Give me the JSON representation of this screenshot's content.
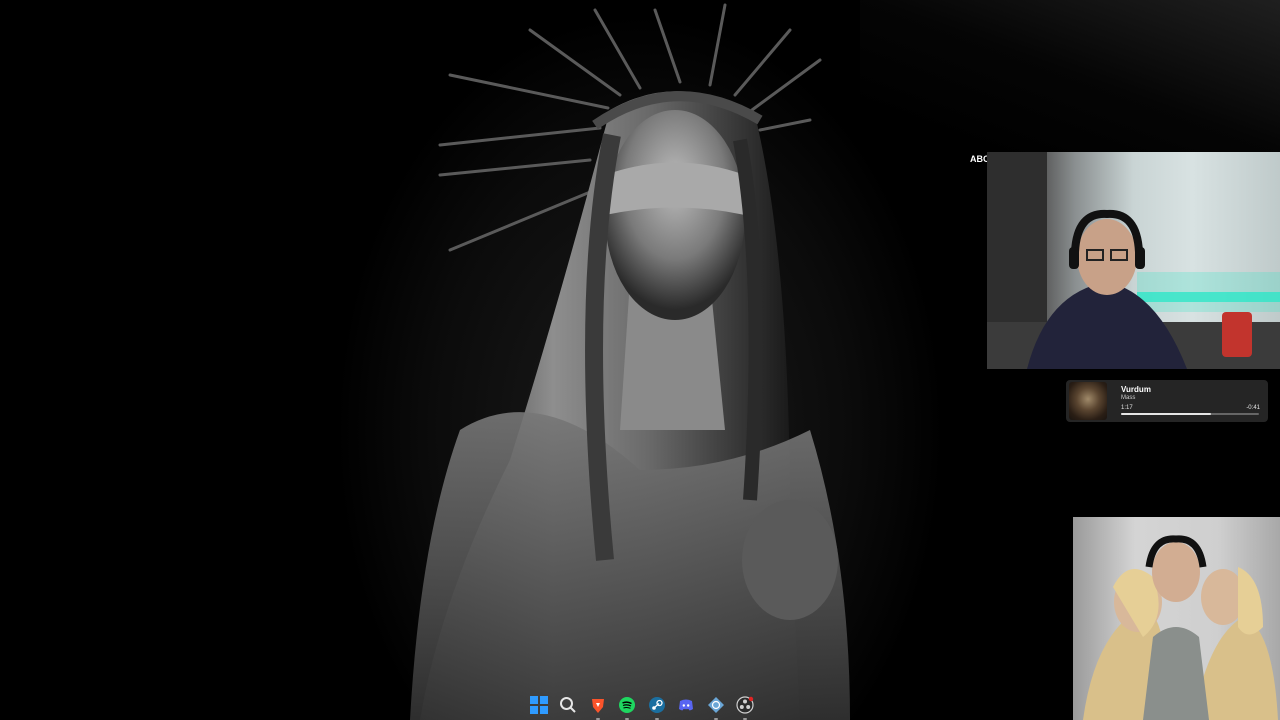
{
  "desktop": {
    "wallpaper_icon": "blindfolded-statue-wallpaper",
    "accent": "#2ee6c8"
  },
  "webcam": {
    "label": "ABC",
    "icon": "webcam-feed"
  },
  "now_playing": {
    "title": "Vurdum",
    "artist": "Mass",
    "elapsed": "1:17",
    "remaining": "-0:41",
    "progress": 0.65
  },
  "photo": {
    "icon": "photo-image"
  },
  "taskbar": {
    "items": [
      {
        "name": "Start",
        "icon": "windows-start-icon",
        "color": "#2f9bff",
        "running": false
      },
      {
        "name": "Search",
        "icon": "search-icon",
        "color": "#e6e6e6",
        "running": false
      },
      {
        "name": "Brave",
        "icon": "brave-icon",
        "color": "#fb542b",
        "running": true
      },
      {
        "name": "Spotify",
        "icon": "spotify-icon",
        "color": "#1ed760",
        "running": true
      },
      {
        "name": "Steam",
        "icon": "steam-icon",
        "color": "#1b6fa0",
        "running": true
      },
      {
        "name": "Discord",
        "icon": "discord-icon",
        "color": "#5865f2",
        "running": false
      },
      {
        "name": "Network",
        "icon": "network-globe-icon",
        "color": "#6aa6d6",
        "running": true
      },
      {
        "name": "OBS",
        "icon": "obs-icon",
        "color": "#d0d0d0",
        "running": true
      }
    ]
  }
}
